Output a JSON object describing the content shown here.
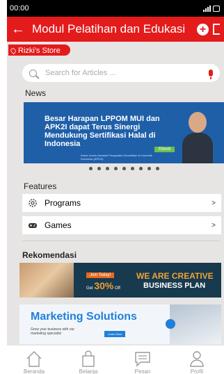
{
  "status": {
    "time": "00:00"
  },
  "appbar": {
    "title": "Modul Pelatihan dan Edukasi"
  },
  "store": {
    "name": "Rizki's Store"
  },
  "search": {
    "placeholder": "Search for Articles ..."
  },
  "news": {
    "label": "News",
    "banner_text": "Besar Harapan LPPOM MUI dan APK2I dapat Terus Sinergi Mendukung Sertifikasi Halal di Indonesia",
    "banner_caption": "Ketua Umum Asosiasi Pengusaha Kecantikan & Kosmetik Indonesia (APK2I)",
    "banner_name": "Efendi",
    "slides": 9
  },
  "features": {
    "label": "Features",
    "items": [
      {
        "label": "Programs",
        "arrow": ">",
        "icon": "settings-icon"
      },
      {
        "label": "Games",
        "arrow": ">",
        "icon": "gamepad-icon"
      }
    ]
  },
  "rekomendasi": {
    "label": "Rekomendasi",
    "promo1": {
      "join": "Join Today!",
      "get": "Get",
      "percent": "30%",
      "off": "Off",
      "headline1": "WE ARE CREATIVE",
      "headline2": "BUSINESS PLAN"
    },
    "promo2": {
      "title": "Marketing Solutions",
      "subtitle": "Grow your business with our marketing specialist",
      "button": "Learn More"
    }
  },
  "bottom_nav": [
    {
      "label": "Beranda",
      "icon": "home-icon"
    },
    {
      "label": "Belanja",
      "icon": "shopping-bag-icon"
    },
    {
      "label": "Pesan",
      "icon": "message-icon"
    },
    {
      "label": "Profil",
      "icon": "profile-icon"
    }
  ],
  "colors": {
    "accent": "#e41b1b",
    "news_banner": "#1f5fa8",
    "promo_dark": "#173a4e"
  }
}
